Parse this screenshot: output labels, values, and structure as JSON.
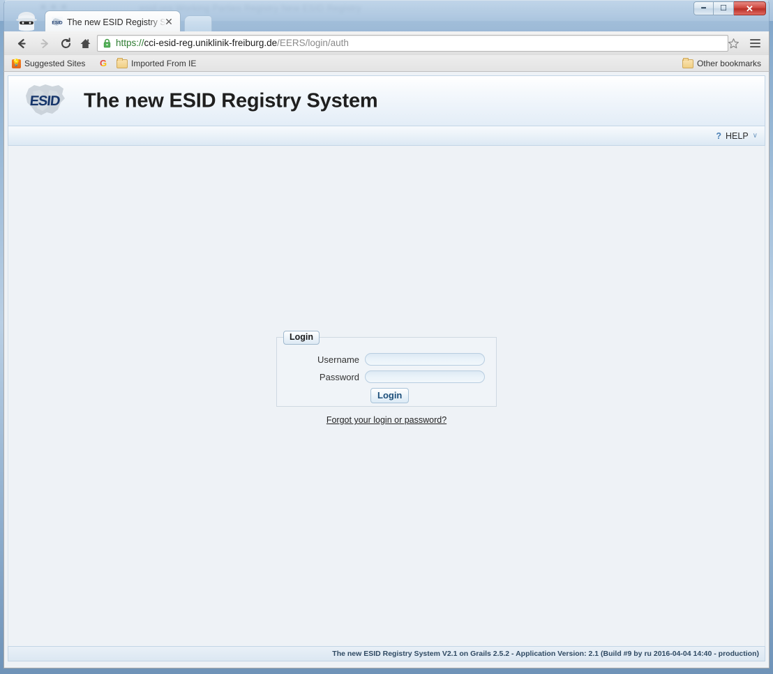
{
  "window": {
    "ghost_title_behind": "esid.org Working Parties Registry New ESID Registry",
    "controls": {
      "minimize_label": "–",
      "maximize_label": "□",
      "close_label": "✕"
    }
  },
  "browser": {
    "tabs": [
      {
        "title": "The new ESID Registry Sys",
        "favicon": "esid-favicon",
        "close_label": "✕"
      }
    ],
    "new_tab_label": "",
    "nav": {
      "back_label": "←",
      "forward_label": "→",
      "reload_label": "⟳",
      "home_label": "⌂"
    },
    "omnibox": {
      "scheme": "https://",
      "host": "cci-esid-reg.uniklinik-freiburg.de",
      "path": "/EERS/login/auth",
      "full_url": "https://cci-esid-reg.uniklinik-freiburg.de/EERS/login/auth",
      "secure_icon": "lock-icon",
      "star_label": "☆"
    },
    "bookmarks": [
      {
        "label": "Suggested Sites",
        "icon": "lightbulb-icon"
      },
      {
        "label": "",
        "icon": "google-icon"
      },
      {
        "label": "Imported From IE",
        "icon": "folder-icon"
      }
    ],
    "other_bookmarks": {
      "label": "Other bookmarks",
      "icon": "folder-icon"
    }
  },
  "page": {
    "header": {
      "logo_alt": "ESID",
      "title": "The new ESID Registry System"
    },
    "nav": {
      "help_label": "HELP",
      "help_icon": "question-mark-icon",
      "help_caret": "∨"
    },
    "login": {
      "legend": "Login",
      "username_label": "Username",
      "username_value": "",
      "username_placeholder": "",
      "password_label": "Password",
      "password_value": "",
      "password_placeholder": "",
      "submit_label": "Login",
      "forgot_link": "Forgot your login or password?"
    },
    "footer": {
      "text": "The new ESID Registry System V2.1 on Grails 2.5.2 - Application Version: 2.1 (Build #9 by ru 2016-04-04 14:40 - production)"
    }
  },
  "colors": {
    "brand_navy": "#17366b",
    "page_bg": "#eef2f6",
    "header_blue": "#e3edf7",
    "footer_text": "#2f4a63",
    "secure_green": "#2f7d32",
    "close_red": "#cf4840"
  }
}
